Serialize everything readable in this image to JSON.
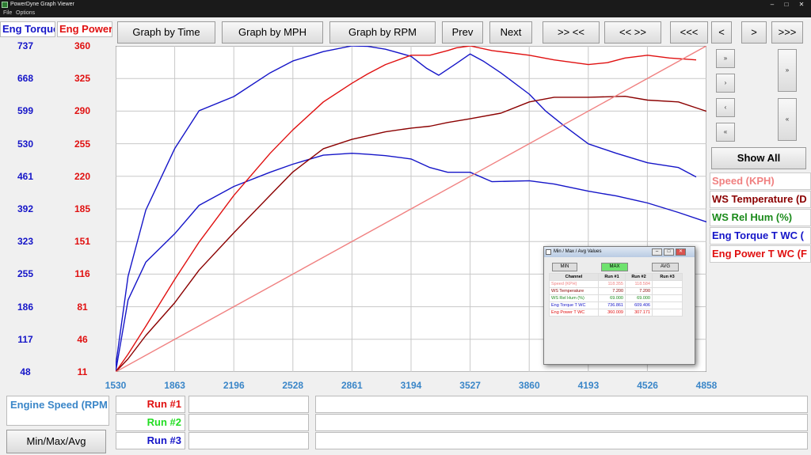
{
  "window": {
    "title": "PowerDyne Graph Viewer"
  },
  "menu": [
    "File",
    "Options"
  ],
  "headers": {
    "torque": "Eng Torque",
    "power": "Eng Power"
  },
  "y_torque_ticks": [
    "737",
    "668",
    "599",
    "530",
    "461",
    "392",
    "323",
    "255",
    "186",
    "117",
    "48"
  ],
  "y_power_ticks": [
    "360",
    "325",
    "290",
    "255",
    "220",
    "185",
    "151",
    "116",
    "81",
    "46",
    "11"
  ],
  "toolbar": {
    "graph_time": "Graph by Time",
    "graph_mph": "Graph by MPH",
    "graph_rpm": "Graph by RPM",
    "prev": "Prev",
    "next": "Next",
    "zoom_in": ">> <<",
    "zoom_out": "<< >>",
    "far_left": "<<<",
    "left": "<",
    "right": ">",
    "far_right": ">>>"
  },
  "side_scroll": [
    "»",
    "›",
    "‹",
    "«"
  ],
  "show_all": "Show All",
  "legend": [
    {
      "label": "Speed (KPH)",
      "color": "#f08080"
    },
    {
      "label": "WS Temperature (D",
      "color": "#8b0000"
    },
    {
      "label": "WS Rel Hum (%)",
      "color": "#1a8a1a"
    },
    {
      "label": "Eng Torque T WC (",
      "color": "#1515c8"
    },
    {
      "label": "Eng Power T WC (F",
      "color": "#e01010"
    }
  ],
  "bottom": {
    "x_channel": "Engine Speed (RPM",
    "run1": "Run #1",
    "run2": "Run #2",
    "run3": "Run #3",
    "minmax_button": "Min/Max/Avg"
  },
  "dialog": {
    "title": "Min / Max / Avg Values",
    "tabs": [
      "MIN",
      "MAX",
      "AVG"
    ],
    "columns": [
      "Channel",
      "Run #1",
      "Run #2",
      "Run #3"
    ],
    "rows": [
      {
        "channel": "Speed (KPH)",
        "run1": "118.355",
        "run2": "118.584",
        "run3": "",
        "color": "#f08080"
      },
      {
        "channel": "WS Temperature",
        "run1": "7.200",
        "run2": "7.200",
        "run3": "",
        "color": "#8b0000"
      },
      {
        "channel": "WS Rel Hum (%)",
        "run1": "69.000",
        "run2": "69.000",
        "run3": "",
        "color": "#1a8a1a"
      },
      {
        "channel": "Eng Torque T WC",
        "run1": "736.861",
        "run2": "609.406",
        "run3": "",
        "color": "#1515c8"
      },
      {
        "channel": "Eng Power T WC",
        "run1": "360.009",
        "run2": "307.171",
        "run3": "",
        "color": "#e01010"
      }
    ]
  },
  "chart_data": {
    "type": "line",
    "xlabel": "Engine Speed (RPM",
    "x_ticks": [
      1530,
      1863,
      2196,
      2528,
      2861,
      3194,
      3527,
      3860,
      4193,
      4526,
      4858
    ],
    "xlim": [
      1530,
      4858
    ],
    "y_torque_lim": [
      48,
      737
    ],
    "y_power_lim": [
      11,
      360
    ],
    "grid": true,
    "series": [
      {
        "name": "Eng Torque T WC",
        "run": "Run #1",
        "axis": "torque",
        "color": "#1515c8",
        "x": [
          1530,
          1600,
          1700,
          1863,
          2000,
          2196,
          2400,
          2528,
          2700,
          2861,
          2950,
          3050,
          3194,
          3280,
          3350,
          3450,
          3527,
          3600,
          3700,
          3860,
          3950,
          4050,
          4193,
          4350,
          4526,
          4700,
          4800
        ],
        "y": [
          60,
          250,
          390,
          520,
          600,
          630,
          680,
          705,
          725,
          737,
          736,
          730,
          715,
          690,
          675,
          700,
          720,
          705,
          680,
          635,
          600,
          570,
          530,
          510,
          490,
          480,
          460
        ]
      },
      {
        "name": "Eng Torque T WC",
        "run": "Run #2",
        "axis": "torque",
        "color": "#1515c8",
        "x": [
          1530,
          1600,
          1700,
          1863,
          2000,
          2196,
          2400,
          2528,
          2700,
          2861,
          2950,
          3050,
          3194,
          3300,
          3400,
          3527,
          3650,
          3860,
          4000,
          4193,
          4350,
          4526,
          4700,
          4858
        ],
        "y": [
          48,
          200,
          280,
          340,
          400,
          440,
          470,
          487,
          506,
          510,
          508,
          505,
          498,
          480,
          470,
          470,
          450,
          452,
          445,
          430,
          420,
          405,
          385,
          365
        ]
      },
      {
        "name": "Eng Power T WC",
        "run": "Run #1",
        "axis": "power",
        "color": "#e01010",
        "x": [
          1530,
          1600,
          1700,
          1863,
          2000,
          2196,
          2400,
          2528,
          2700,
          2861,
          2950,
          3050,
          3194,
          3300,
          3400,
          3450,
          3527,
          3650,
          3860,
          4000,
          4193,
          4300,
          4400,
          4526,
          4650,
          4800
        ],
        "y": [
          11,
          30,
          60,
          110,
          150,
          200,
          245,
          270,
          300,
          320,
          330,
          340,
          350,
          350,
          355,
          358,
          360,
          355,
          350,
          345,
          340,
          342,
          347,
          350,
          347,
          345
        ]
      },
      {
        "name": "Eng Power T WC",
        "run": "Run #2",
        "axis": "power",
        "color": "#8b0000",
        "x": [
          1530,
          1600,
          1700,
          1863,
          2000,
          2196,
          2400,
          2528,
          2700,
          2861,
          3050,
          3194,
          3300,
          3400,
          3527,
          3700,
          3860,
          4000,
          4193,
          4400,
          4526,
          4700,
          4858
        ],
        "y": [
          11,
          25,
          50,
          85,
          120,
          160,
          200,
          225,
          250,
          260,
          268,
          272,
          274,
          278,
          282,
          288,
          300,
          305,
          305,
          306,
          302,
          300,
          290
        ]
      },
      {
        "name": "Speed (KPH)",
        "run": "Run #1",
        "axis": "power",
        "color": "#f08080",
        "x": [
          1530,
          4858
        ],
        "y": [
          11,
          360
        ]
      }
    ]
  }
}
